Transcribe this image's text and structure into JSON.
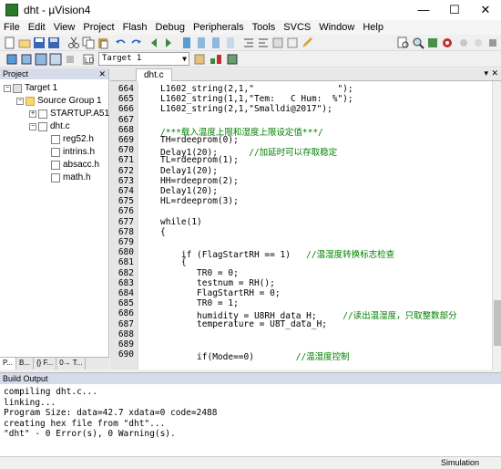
{
  "window": {
    "title": "dht - µVision4",
    "minimize": "—",
    "maximize": "☐",
    "close": "✕"
  },
  "menu": [
    "File",
    "Edit",
    "View",
    "Project",
    "Flash",
    "Debug",
    "Peripherals",
    "Tools",
    "SVCS",
    "Window",
    "Help"
  ],
  "toolbar": {
    "target": "Target 1"
  },
  "project": {
    "header": "Project",
    "tree": [
      {
        "label": "Target 1",
        "depth": 0
      },
      {
        "label": "Source Group 1",
        "depth": 1
      },
      {
        "label": "STARTUP.A51",
        "depth": 2
      },
      {
        "label": "dht.c",
        "depth": 2
      },
      {
        "label": "reg52.h",
        "depth": 3
      },
      {
        "label": "intrins.h",
        "depth": 3
      },
      {
        "label": "absacc.h",
        "depth": 3
      },
      {
        "label": "math.h",
        "depth": 3
      }
    ],
    "tabs": [
      "P...",
      "B...",
      "{} F...",
      "0→ T..."
    ]
  },
  "editor": {
    "tab": "dht.c",
    "lines": [
      {
        "n": "664",
        "code": "L1602_string(2,1,\"                \");"
      },
      {
        "n": "665",
        "code": "L1602_string(1,1,\"Tem:   C Hum:  %\");"
      },
      {
        "n": "666",
        "code": "L1602_string(2,1,\"Smalldi@2017\");"
      },
      {
        "n": "667",
        "code": ""
      },
      {
        "n": "668",
        "code": "/***载入温度上限和湿度上限设定值***/",
        "comment": true
      },
      {
        "n": "669",
        "code": "TH=rdeeprom(0);"
      },
      {
        "n": "670",
        "code": "Delay1(20);      ",
        "trail": "//加延时可以存取稳定"
      },
      {
        "n": "671",
        "code": "TL=rdeeprom(1);"
      },
      {
        "n": "672",
        "code": "Delay1(20);"
      },
      {
        "n": "673",
        "code": "HH=rdeeprom(2);"
      },
      {
        "n": "674",
        "code": "Delay1(20);"
      },
      {
        "n": "675",
        "code": "HL=rdeeprom(3);"
      },
      {
        "n": "676",
        "code": ""
      },
      {
        "n": "677",
        "code": "while(1)"
      },
      {
        "n": "678",
        "code": "{"
      },
      {
        "n": "679",
        "code": ""
      },
      {
        "n": "680",
        "code": "    if (FlagStartRH == 1)   ",
        "trail": "//温湿度转换标志检查"
      },
      {
        "n": "681",
        "code": "    {"
      },
      {
        "n": "682",
        "code": "       TR0 = 0;"
      },
      {
        "n": "683",
        "code": "       testnum = RH();"
      },
      {
        "n": "684",
        "code": "       FlagStartRH = 0;"
      },
      {
        "n": "685",
        "code": "       TR0 = 1;"
      },
      {
        "n": "686",
        "code": "       humidity = U8RH_data_H;     ",
        "trail": "//读出温湿度，只取整数部分"
      },
      {
        "n": "687",
        "code": "       temperature = U8T_data_H;"
      },
      {
        "n": "688",
        "code": ""
      },
      {
        "n": "689",
        "code": ""
      },
      {
        "n": "690",
        "code": "       if(Mode==0)        ",
        "trail": "//温湿度控制"
      }
    ]
  },
  "build": {
    "header": "Build Output",
    "lines": [
      "compiling dht.c...",
      "linking...",
      "Program Size: data=42.7 xdata=0 code=2488",
      "creating hex file from \"dht\"...",
      "\"dht\" - 0 Error(s), 0 Warning(s)."
    ]
  },
  "status": {
    "mode": "Simulation"
  }
}
